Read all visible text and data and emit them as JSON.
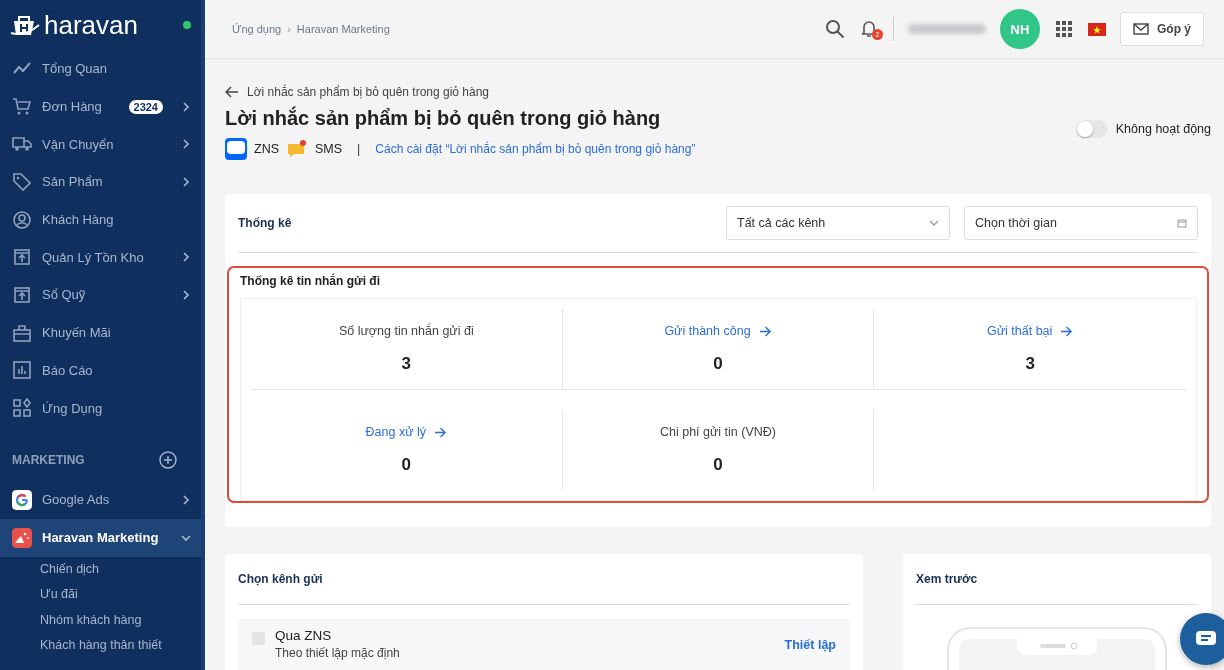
{
  "sidebar": {
    "brand": "haravan",
    "online": true,
    "items": [
      {
        "label": "Tổng Quan",
        "chevron": false
      },
      {
        "label": "Đơn Hàng",
        "badge": "2324",
        "chevron": true
      },
      {
        "label": "Vận Chuyển",
        "chevron": true
      },
      {
        "label": "Sản Phẩm",
        "chevron": true
      },
      {
        "label": "Khách Hàng",
        "chevron": false
      },
      {
        "label": "Quản Lý Tồn Kho",
        "chevron": true
      },
      {
        "label": "Sổ Quỹ",
        "chevron": true
      },
      {
        "label": "Khuyến Mãi",
        "chevron": false
      },
      {
        "label": "Báo Cáo",
        "chevron": false
      },
      {
        "label": "Ứng Dụng",
        "chevron": false
      }
    ],
    "section": "MARKETING",
    "apps": [
      {
        "label": "Google Ads",
        "selected": false,
        "expanded": false
      },
      {
        "label": "Haravan Marketing",
        "selected": true,
        "expanded": true,
        "children": [
          "Chiến dịch",
          "Ưu đãi",
          "Nhóm khách hàng",
          "Khách hàng thân thiết"
        ]
      }
    ]
  },
  "topbar": {
    "breadcrumb": [
      "Ứng dụng",
      "Haravan Marketing"
    ],
    "breadcrumb_separator": "›",
    "notifications": "2",
    "avatar": "NH",
    "feedback": "Góp ý"
  },
  "page": {
    "back": "Lời nhắc sản phẩm bị bỏ quên trong giỏ hàng",
    "title": "Lời nhắc sản phẩm bị bỏ quên trong giỏ hàng",
    "channels": [
      "ZNS",
      "SMS"
    ],
    "separator": "|",
    "guide_link": "Cách cài đặt “Lời nhắc sản phẩm bị bỏ quên trong giỏ hàng”",
    "toggle": {
      "label": "Không hoạt động",
      "on": false
    }
  },
  "stats": {
    "title": "Thống kê",
    "channel_select": "Tất cả các kênh",
    "date_placeholder": "Chọn thời gian",
    "subtitle": "Thống kê tin nhắn gửi đi",
    "cells": [
      {
        "kind": "plain",
        "label": "Số lượng tin nhắn gửi đi",
        "value": "3"
      },
      {
        "kind": "link",
        "label": "Gửi thành công",
        "value": "0"
      },
      {
        "kind": "link",
        "label": "Gửi thất bại",
        "value": "3"
      },
      {
        "kind": "link",
        "label": "Đang xử lý",
        "value": "0"
      },
      {
        "kind": "plain",
        "label": "Chi phí gửi tin (VNĐ)",
        "value": "0"
      }
    ]
  },
  "send_channels": {
    "title": "Chọn kênh gửi",
    "options": [
      {
        "name": "Qua ZNS",
        "description": "Theo thiết lập mặc định",
        "checked": false,
        "action": "Thiết lập"
      }
    ]
  },
  "preview": {
    "title": "Xem trước"
  }
}
